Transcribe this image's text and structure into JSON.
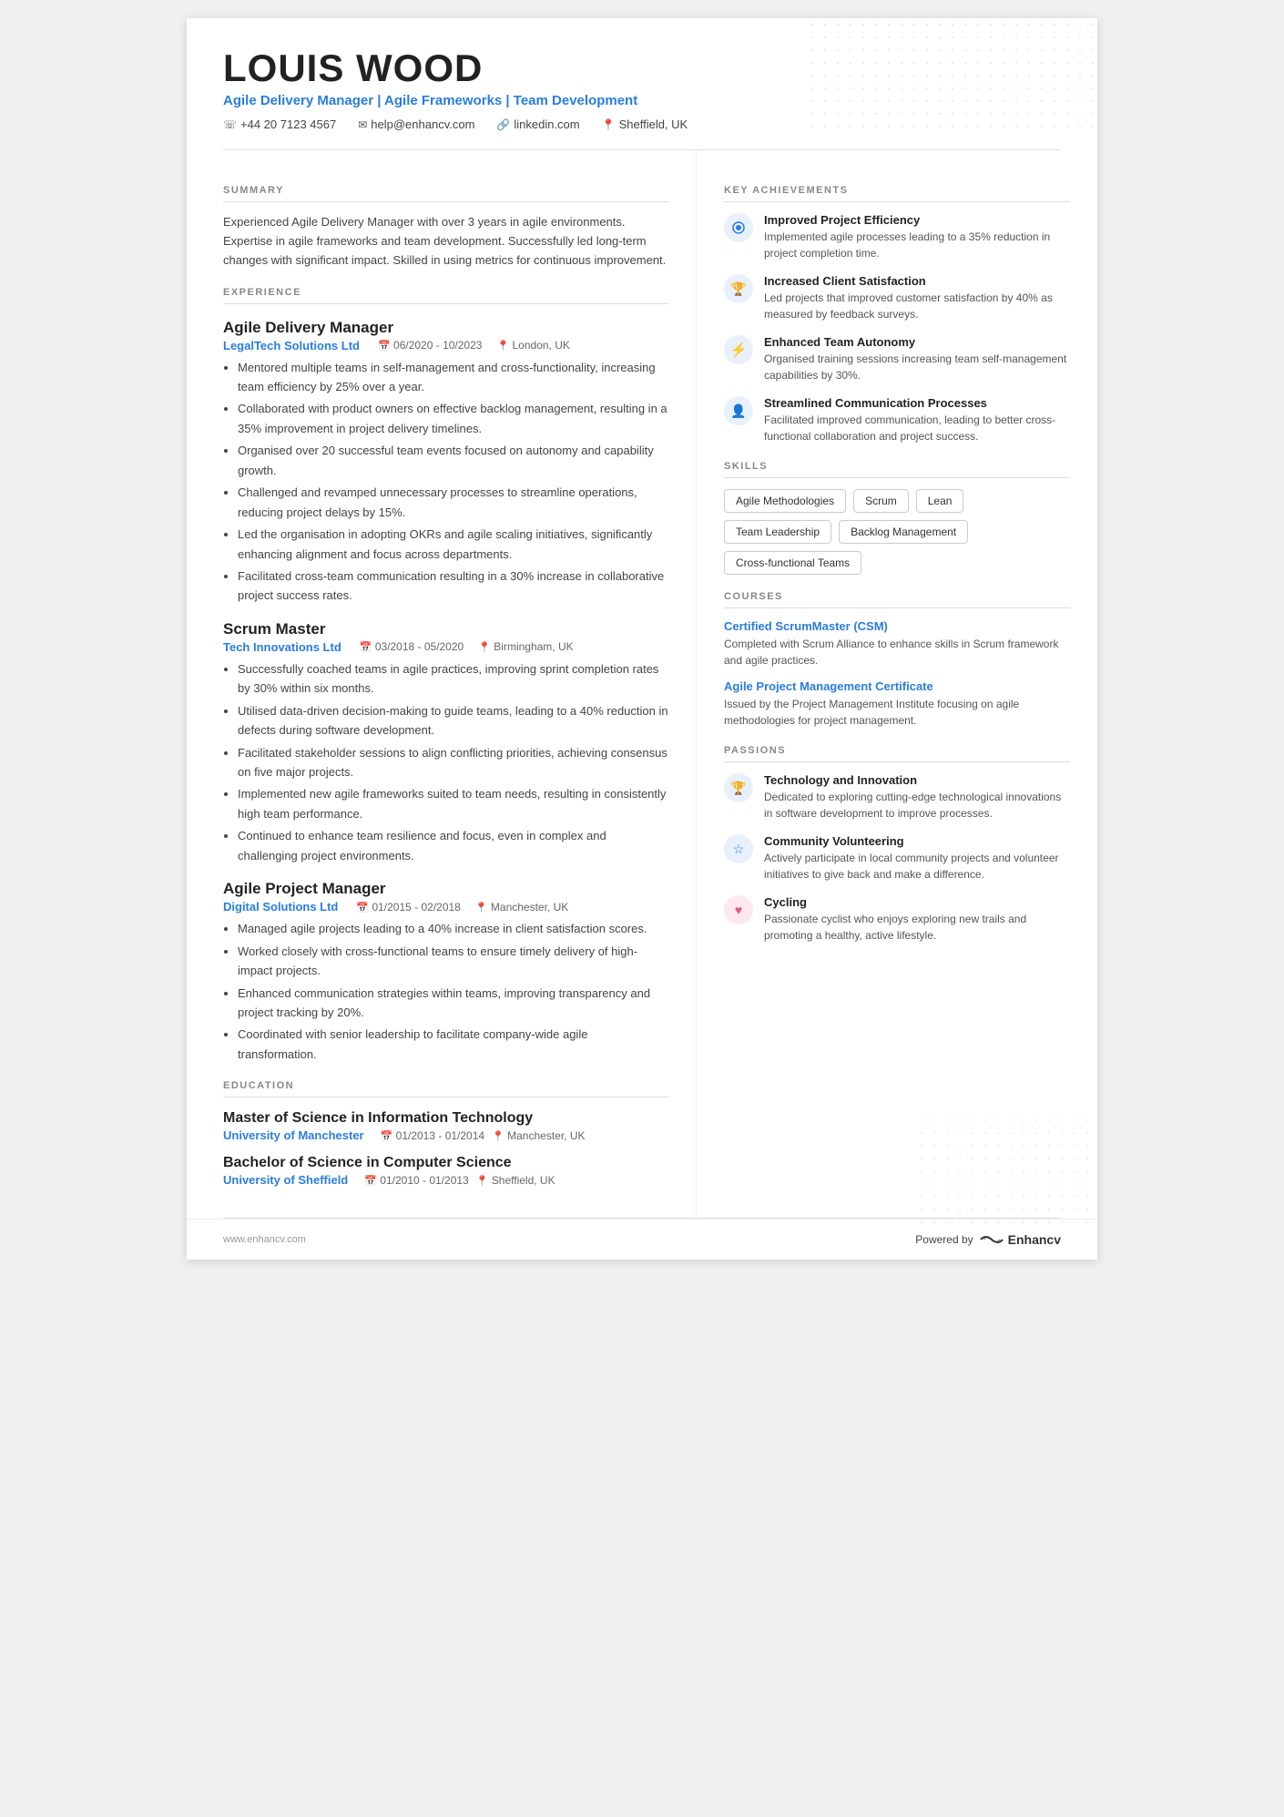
{
  "header": {
    "name": "LOUIS WOOD",
    "title": "Agile Delivery Manager | Agile Frameworks | Team Development",
    "phone": "+44 20 7123 4567",
    "email": "help@enhancv.com",
    "linkedin": "linkedin.com",
    "location": "Sheffield, UK"
  },
  "summary": {
    "section_title": "SUMMARY",
    "text": "Experienced Agile Delivery Manager with over 3 years in agile environments. Expertise in agile frameworks and team development. Successfully led long-term changes with significant impact. Skilled in using metrics for continuous improvement."
  },
  "experience": {
    "section_title": "EXPERIENCE",
    "jobs": [
      {
        "title": "Agile Delivery Manager",
        "company": "LegalTech Solutions Ltd",
        "dates": "06/2020 - 10/2023",
        "location": "London, UK",
        "bullets": [
          "Mentored multiple teams in self-management and cross-functionality, increasing team efficiency by 25% over a year.",
          "Collaborated with product owners on effective backlog management, resulting in a 35% improvement in project delivery timelines.",
          "Organised over 20 successful team events focused on autonomy and capability growth.",
          "Challenged and revamped unnecessary processes to streamline operations, reducing project delays by 15%.",
          "Led the organisation in adopting OKRs and agile scaling initiatives, significantly enhancing alignment and focus across departments.",
          "Facilitated cross-team communication resulting in a 30% increase in collaborative project success rates."
        ]
      },
      {
        "title": "Scrum Master",
        "company": "Tech Innovations Ltd",
        "dates": "03/2018 - 05/2020",
        "location": "Birmingham, UK",
        "bullets": [
          "Successfully coached teams in agile practices, improving sprint completion rates by 30% within six months.",
          "Utilised data-driven decision-making to guide teams, leading to a 40% reduction in defects during software development.",
          "Facilitated stakeholder sessions to align conflicting priorities, achieving consensus on five major projects.",
          "Implemented new agile frameworks suited to team needs, resulting in consistently high team performance.",
          "Continued to enhance team resilience and focus, even in complex and challenging project environments."
        ]
      },
      {
        "title": "Agile Project Manager",
        "company": "Digital Solutions Ltd",
        "dates": "01/2015 - 02/2018",
        "location": "Manchester, UK",
        "bullets": [
          "Managed agile projects leading to a 40% increase in client satisfaction scores.",
          "Worked closely with cross-functional teams to ensure timely delivery of high-impact projects.",
          "Enhanced communication strategies within teams, improving transparency and project tracking by 20%.",
          "Coordinated with senior leadership to facilitate company-wide agile transformation."
        ]
      }
    ]
  },
  "education": {
    "section_title": "EDUCATION",
    "degrees": [
      {
        "degree": "Master of Science in Information Technology",
        "school": "University of Manchester",
        "dates": "01/2013 - 01/2014",
        "location": "Manchester, UK"
      },
      {
        "degree": "Bachelor of Science in Computer Science",
        "school": "University of Sheffield",
        "dates": "01/2010 - 01/2013",
        "location": "Sheffield, UK"
      }
    ]
  },
  "key_achievements": {
    "section_title": "KEY ACHIEVEMENTS",
    "items": [
      {
        "icon": "🔵",
        "title": "Improved Project Efficiency",
        "desc": "Implemented agile processes leading to a 35% reduction in project completion time.",
        "icon_type": "gear"
      },
      {
        "icon": "🏆",
        "title": "Increased Client Satisfaction",
        "desc": "Led projects that improved customer satisfaction by 40% as measured by feedback surveys.",
        "icon_type": "trophy"
      },
      {
        "icon": "⚡",
        "title": "Enhanced Team Autonomy",
        "desc": "Organised training sessions increasing team self-management capabilities by 30%.",
        "icon_type": "bolt"
      },
      {
        "icon": "👤",
        "title": "Streamlined Communication Processes",
        "desc": "Facilitated improved communication, leading to better cross-functional collaboration and project success.",
        "icon_type": "person"
      }
    ]
  },
  "skills": {
    "section_title": "SKILLS",
    "items": [
      "Agile Methodologies",
      "Scrum",
      "Lean",
      "Team Leadership",
      "Backlog Management",
      "Cross-functional Teams"
    ]
  },
  "courses": {
    "section_title": "COURSES",
    "items": [
      {
        "title": "Certified ScrumMaster (CSM)",
        "desc": "Completed with Scrum Alliance to enhance skills in Scrum framework and agile practices."
      },
      {
        "title": "Agile Project Management Certificate",
        "desc": "Issued by the Project Management Institute focusing on agile methodologies for project management."
      }
    ]
  },
  "passions": {
    "section_title": "PASSIONS",
    "items": [
      {
        "title": "Technology and Innovation",
        "desc": "Dedicated to exploring cutting-edge technological innovations in software development to improve processes.",
        "icon_type": "trophy"
      },
      {
        "title": "Community Volunteering",
        "desc": "Actively participate in local community projects and volunteer initiatives to give back and make a difference.",
        "icon_type": "star"
      },
      {
        "title": "Cycling",
        "desc": "Passionate cyclist who enjoys exploring new trails and promoting a healthy, active lifestyle.",
        "icon_type": "heart"
      }
    ]
  },
  "footer": {
    "website": "www.enhancv.com",
    "powered_by": "Powered by",
    "brand": "Enhancv"
  }
}
